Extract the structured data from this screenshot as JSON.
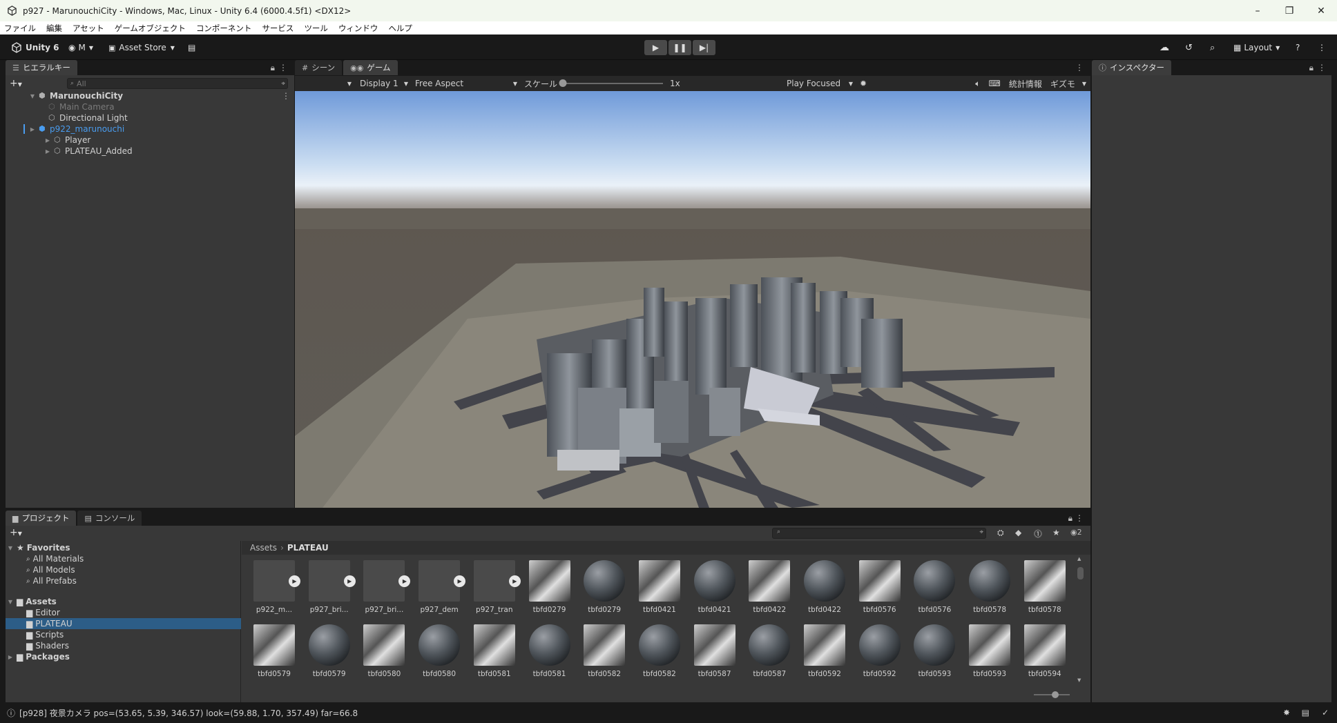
{
  "window": {
    "title": "p927 - MarunouchiCity - Windows, Mac, Linux - Unity 6.4 (6000.4.5f1) <DX12>",
    "minimize": "–",
    "maximize": "❐",
    "close": "✕"
  },
  "menu": [
    "ファイル",
    "編集",
    "アセット",
    "ゲームオブジェクト",
    "コンポーネント",
    "サービス",
    "ツール",
    "ウィンドウ",
    "ヘルプ"
  ],
  "toolbar": {
    "unity_label": "Unity 6",
    "account_label": "M",
    "asset_store_label": "Asset Store",
    "layout_label": "Layout"
  },
  "hierarchy": {
    "tab_label": "ヒエラルキー",
    "search_placeholder": "All",
    "scene_name": "MarunouchiCity",
    "items": [
      {
        "label": "Main Camera"
      },
      {
        "label": "Directional Light"
      },
      {
        "label": "p922_marunouchi"
      },
      {
        "label": "Player"
      },
      {
        "label": "PLATEAU_Added"
      }
    ]
  },
  "scene_tabs": {
    "scene": "シーン",
    "game": "ゲーム"
  },
  "game_bar": {
    "display": "Display 1",
    "aspect": "Free Aspect",
    "scale_label": "スケール",
    "scale_value": "1x",
    "scale_level": 0,
    "play_mode": "Play Focused",
    "stats": "統計情報",
    "gizmos": "ギズモ"
  },
  "inspector": {
    "tab_label": "インスペクター"
  },
  "project": {
    "tab_project": "プロジェクト",
    "tab_console": "コンソール",
    "favorites_label": "Favorites",
    "favorites": [
      "All Materials",
      "All Models",
      "All Prefabs"
    ],
    "assets_label": "Assets",
    "folders": [
      "Editor",
      "PLATEAU",
      "Scripts",
      "Shaders"
    ],
    "packages_label": "Packages",
    "breadcrumb_root": "Assets",
    "breadcrumb_current": "PLATEAU",
    "hidden_count": "2",
    "row1": [
      {
        "name": "p922_m...",
        "kind": "model"
      },
      {
        "name": "p927_bri...",
        "kind": "model"
      },
      {
        "name": "p927_bri...",
        "kind": "model"
      },
      {
        "name": "p927_dem",
        "kind": "model"
      },
      {
        "name": "p927_tran",
        "kind": "model"
      },
      {
        "name": "tbfd0279",
        "kind": "texture"
      },
      {
        "name": "tbfd0279",
        "kind": "material"
      },
      {
        "name": "tbfd0421",
        "kind": "texture"
      },
      {
        "name": "tbfd0421",
        "kind": "material"
      },
      {
        "name": "tbfd0422",
        "kind": "texture"
      },
      {
        "name": "tbfd0422",
        "kind": "material"
      },
      {
        "name": "tbfd0576",
        "kind": "texture"
      },
      {
        "name": "tbfd0576",
        "kind": "material"
      },
      {
        "name": "tbfd0578",
        "kind": "material"
      },
      {
        "name": "tbfd0578",
        "kind": "texture"
      }
    ],
    "row2": [
      {
        "name": "tbfd0579",
        "kind": "texture"
      },
      {
        "name": "tbfd0579",
        "kind": "material"
      },
      {
        "name": "tbfd0580",
        "kind": "texture"
      },
      {
        "name": "tbfd0580",
        "kind": "material"
      },
      {
        "name": "tbfd0581",
        "kind": "texture"
      },
      {
        "name": "tbfd0581",
        "kind": "material"
      },
      {
        "name": "tbfd0582",
        "kind": "texture"
      },
      {
        "name": "tbfd0582",
        "kind": "material"
      },
      {
        "name": "tbfd0587",
        "kind": "texture"
      },
      {
        "name": "tbfd0587",
        "kind": "material"
      },
      {
        "name": "tbfd0592",
        "kind": "texture"
      },
      {
        "name": "tbfd0592",
        "kind": "material"
      },
      {
        "name": "tbfd0593",
        "kind": "material"
      },
      {
        "name": "tbfd0593",
        "kind": "texture"
      },
      {
        "name": "tbfd0594",
        "kind": "texture"
      }
    ]
  },
  "status": {
    "message": "[p928] 夜景カメラ pos=(53.65, 5.39, 346.57) look=(59.88, 1.70, 357.49) far=66.8"
  },
  "colors": {
    "selected": "#2c5d87",
    "accent_blue": "#4a9df0",
    "sky_top": "#6f9ad9",
    "ground": "#6d6a60"
  }
}
